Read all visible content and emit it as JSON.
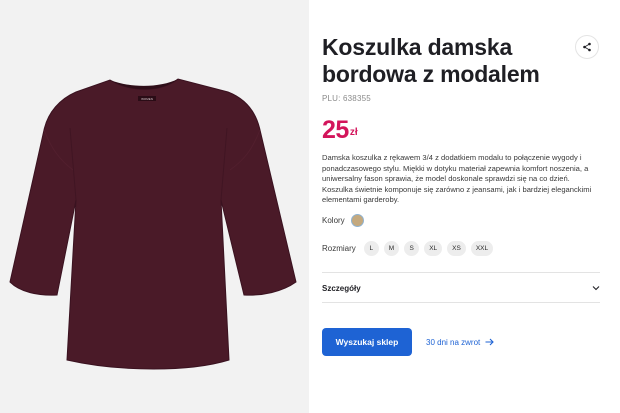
{
  "product": {
    "title": "Koszulka damska bordowa z modalem",
    "plu": "PLU: 638355",
    "price_amount": "25",
    "price_currency": "zł",
    "description": "Damska koszulka z rękawem 3/4 z dodatkiem modalu to połączenie wygody i ponadczasowego stylu. Miękki w dotyku materiał zapewnia komfort noszenia, a uniwersalny fason sprawia, że model doskonale sprawdzi się na co dzień. Koszulka świetnie komponuje się zarówno z jeansami, jak i bardziej eleganckimi elementami garderoby.",
    "image_label": "WOMEN"
  },
  "colors": {
    "label": "Kolory",
    "swatch_color": "#c4a97e"
  },
  "sizes": {
    "label": "Rozmiary",
    "options": [
      "L",
      "M",
      "S",
      "XL",
      "XS",
      "XXL"
    ]
  },
  "details": {
    "label": "Szczegóły"
  },
  "actions": {
    "search_store": "Wyszukaj sklep",
    "return_policy": "30 dni na zwrot"
  },
  "icons": {
    "share": "share-icon",
    "chevron": "chevron-down-icon",
    "arrow": "arrow-right-icon"
  },
  "theme": {
    "accent": "#1e63d4",
    "price": "#d3155b",
    "garment": "#4a1a28",
    "image_bg": "#f2f2f2"
  }
}
